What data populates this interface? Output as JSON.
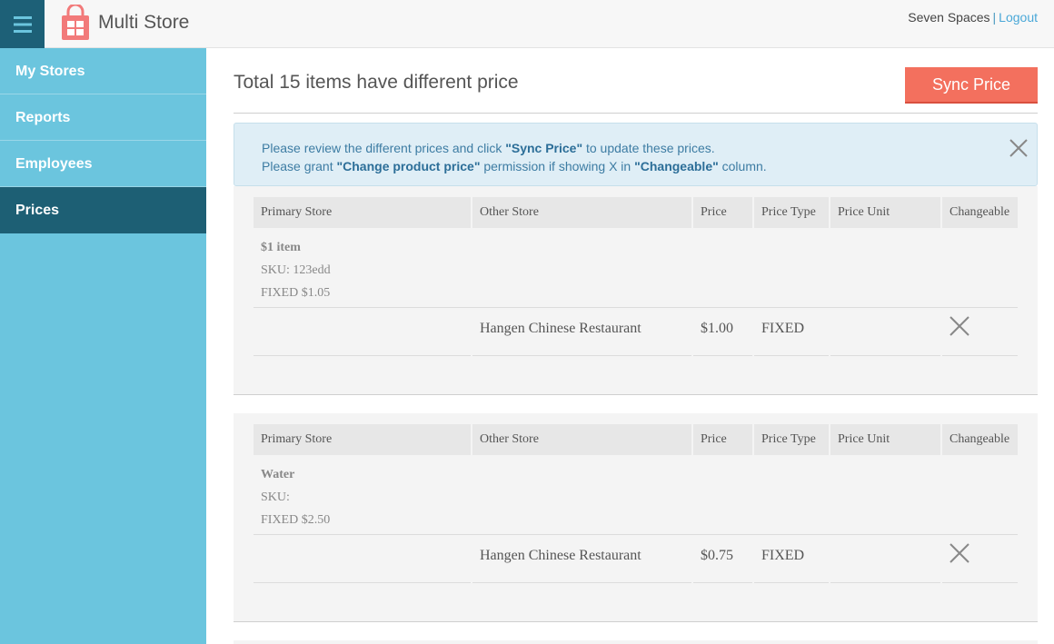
{
  "header": {
    "app_title": "Multi Store",
    "user_name": "Seven Spaces",
    "separator": "|",
    "logout": "Logout"
  },
  "sidebar": {
    "items": [
      {
        "label": "My Stores"
      },
      {
        "label": "Reports"
      },
      {
        "label": "Employees"
      },
      {
        "label": "Prices",
        "active": true
      }
    ]
  },
  "main": {
    "title": "Total 15 items have different price",
    "sync_button": "Sync Price",
    "alert": {
      "line1_pre": "Please review the different prices and click ",
      "line1_bold": "\"Sync Price\"",
      "line1_post": " to update these prices.",
      "line2_pre": "Please grant ",
      "line2_bold1": "\"Change product price\"",
      "line2_mid": " permission if showing X in ",
      "line2_bold2": "\"Changeable\"",
      "line2_post": " column."
    },
    "columns": [
      "Primary Store",
      "Other Store",
      "Price",
      "Price Type",
      "Price Unit",
      "Changeable"
    ],
    "items": [
      {
        "name": "$1 item",
        "sku": "SKU: 123edd",
        "primary_price": "FIXED $1.05",
        "other": {
          "store": "Hangen Chinese Restaurant",
          "price": "$1.00",
          "price_type": "FIXED",
          "price_unit": "",
          "changeable": "x-icon"
        }
      },
      {
        "name": "Water",
        "sku": "SKU:",
        "primary_price": "FIXED $2.50",
        "other": {
          "store": "Hangen Chinese Restaurant",
          "price": "$0.75",
          "price_type": "FIXED",
          "price_unit": "",
          "changeable": "x-icon"
        }
      }
    ]
  },
  "colors": {
    "sidebar_bg": "#6bc5de",
    "sidebar_active": "#1d5f74",
    "accent_button": "#f3705e",
    "alert_bg": "#dfeef6",
    "logo": "#f27a7a"
  }
}
